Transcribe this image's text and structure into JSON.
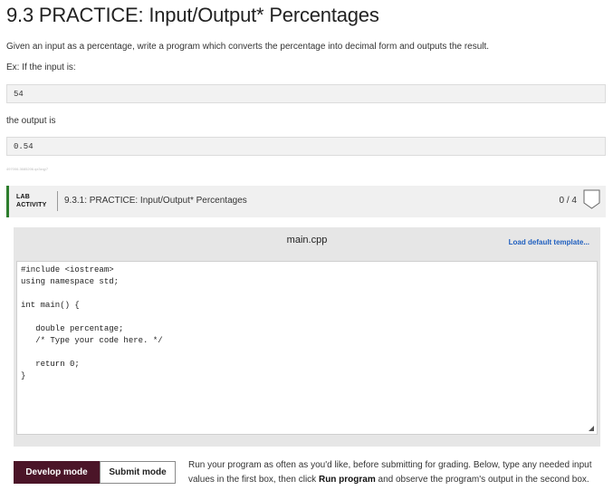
{
  "page": {
    "title": "9.3 PRACTICE: Input/Output* Percentages",
    "description": "Given an input as a percentage, write a program which converts the percentage into decimal form and outputs the result.",
    "example_intro": "Ex: If the input is:",
    "example_input": "54",
    "output_intro": "the output is",
    "example_output": "0.54",
    "tiny_id": "497006.3685206.qx3zqy7"
  },
  "lab": {
    "tag_line1": "LAB",
    "tag_line2": "ACTIVITY",
    "title": "9.3.1: PRACTICE: Input/Output* Percentages",
    "score": "0 / 4",
    "badge_icon": "badge-shield-icon"
  },
  "editor": {
    "file_name": "main.cpp",
    "load_template": "Load default template...",
    "code_lines": [
      "#include <iostream>",
      "using namespace std;",
      "",
      "int main() {",
      "",
      "   double percentage;",
      "   /* Type your code here. */",
      "",
      "   return 0;",
      "}"
    ],
    "resize_icon": "resize-grip-icon"
  },
  "modes": {
    "develop": "Develop mode",
    "submit": "Submit mode"
  },
  "run_note": {
    "part1": "Run your program as often as you'd like, before submitting for grading. Below, type any needed input values in the first box, then click ",
    "bold": "Run program",
    "part2": " and observe the program's output in the second box."
  },
  "colors": {
    "develop_bg": "#4b1528",
    "lab_accent": "#2d7d2d",
    "link": "#1f5fbf"
  }
}
